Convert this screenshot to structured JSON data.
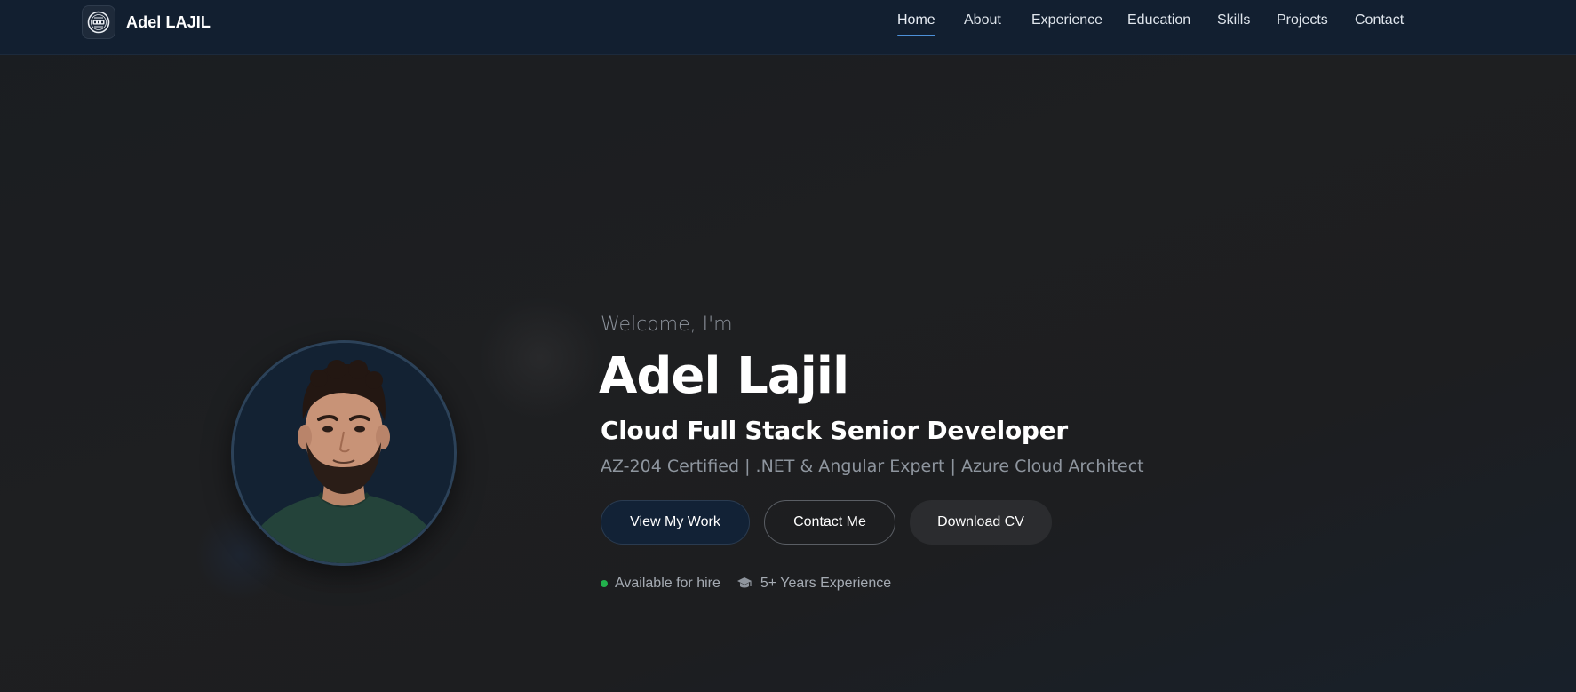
{
  "brand": {
    "name": "Adel LAJIL",
    "logo_icon": "monogram-logo-icon"
  },
  "nav": {
    "items": [
      {
        "label": "Home",
        "active": true
      },
      {
        "label": "About",
        "active": false
      },
      {
        "label": "Experience",
        "active": false
      },
      {
        "label": "Education",
        "active": false
      },
      {
        "label": "Skills",
        "active": false
      },
      {
        "label": "Projects",
        "active": false
      },
      {
        "label": "Contact",
        "active": false
      }
    ],
    "active_color": "#4d90d8"
  },
  "hero": {
    "greeting": "Welcome, I'm",
    "name": "Adel Lajil",
    "role": "Cloud Full Stack Senior Developer",
    "tagline": "AZ-204 Certified | .NET & Angular Expert | Azure Cloud Architect",
    "buttons": {
      "view_work": "View My Work",
      "contact": "Contact Me",
      "download_cv": "Download CV"
    },
    "status": {
      "availability": "Available for hire",
      "availability_color": "#22b14c",
      "experience": "5+ Years Experience",
      "experience_icon": "graduation-cap-icon"
    }
  },
  "colors": {
    "navbar_bg": "#121f30",
    "page_bg": "#1d1e20",
    "primary_button_bg": "#122236"
  }
}
